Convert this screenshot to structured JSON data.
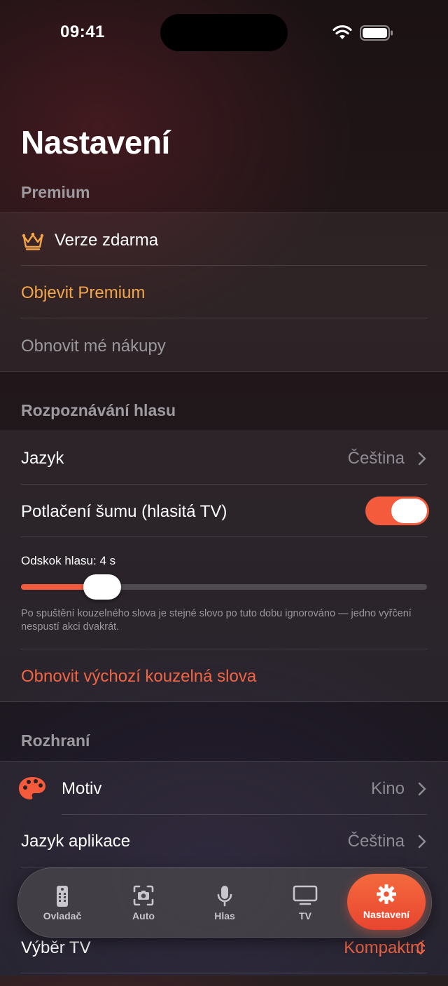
{
  "status": {
    "time": "09:41"
  },
  "page": {
    "title": "Nastavení"
  },
  "premium": {
    "header": "Premium",
    "plan_label": "Verze zdarma",
    "discover_label": "Objevit Premium",
    "restore_label": "Obnovit mé nákupy"
  },
  "voice": {
    "header": "Rozpoznávání hlasu",
    "language_label": "Jazyk",
    "language_value": "Čeština",
    "noise_label": "Potlačení šumu (hlasitá TV)",
    "noise_enabled": true,
    "debounce_label": "Odskok hlasu: 4 s",
    "debounce_fraction": 0.2,
    "debounce_hint": "Po spuštění kouzelného slova je stejné slovo po tuto dobu ignorováno — jedno vyřčení nespustí akci dvakrát.",
    "reset_label": "Obnovit výchozí kouzelná slova"
  },
  "interface": {
    "header": "Rozhraní",
    "theme_label": "Motiv",
    "theme_value": "Kino",
    "app_language_label": "Jazyk aplikace",
    "app_language_value": "Čeština",
    "tv_select_label": "Výběr TV",
    "tv_select_value": "Kompaktní"
  },
  "tabs": [
    {
      "label": "Ovladač",
      "icon": "remote-icon"
    },
    {
      "label": "Auto",
      "icon": "camera-scan-icon"
    },
    {
      "label": "Hlas",
      "icon": "microphone-icon"
    },
    {
      "label": "TV",
      "icon": "tv-icon"
    },
    {
      "label": "Nastavení",
      "icon": "gear-icon",
      "active": true
    }
  ],
  "colors": {
    "accent": "#f45a3c",
    "premium": "#f2a54a"
  }
}
